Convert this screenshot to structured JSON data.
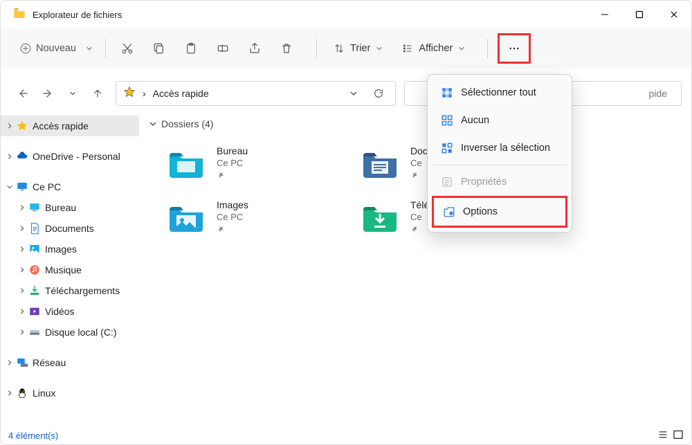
{
  "window": {
    "title": "Explorateur de fichiers"
  },
  "toolbar": {
    "new_label": "Nouveau",
    "sort_label": "Trier",
    "view_label": "Afficher"
  },
  "address": {
    "crumb_separator": "›",
    "crumb": "Accès rapide"
  },
  "search": {
    "placeholder_tail": "pide"
  },
  "sidebar": {
    "items": [
      {
        "label": "Accès rapide",
        "icon": "star",
        "indent": 1,
        "expander": "right",
        "selected": true
      },
      {
        "label": "OneDrive - Personal",
        "icon": "onedrive",
        "indent": 1,
        "expander": "right"
      },
      {
        "label": "Ce PC",
        "icon": "monitor",
        "indent": 1,
        "expander": "down"
      },
      {
        "label": "Bureau",
        "icon": "desktop",
        "indent": 2,
        "expander": "right"
      },
      {
        "label": "Documents",
        "icon": "doc",
        "indent": 2,
        "expander": "right"
      },
      {
        "label": "Images",
        "icon": "images",
        "indent": 2,
        "expander": "right"
      },
      {
        "label": "Musique",
        "icon": "music",
        "indent": 2,
        "expander": "right"
      },
      {
        "label": "Téléchargements",
        "icon": "download",
        "indent": 2,
        "expander": "right"
      },
      {
        "label": "Vidéos",
        "icon": "video",
        "indent": 2,
        "expander": "right"
      },
      {
        "label": "Disque local (C:)",
        "icon": "disk",
        "indent": 2,
        "expander": "right"
      },
      {
        "label": "Réseau",
        "icon": "network",
        "indent": 1,
        "expander": "right"
      },
      {
        "label": "Linux",
        "icon": "linux",
        "indent": 1,
        "expander": "right"
      }
    ]
  },
  "content": {
    "section_label": "Dossiers (4)",
    "folders": [
      {
        "name": "Bureau",
        "loc": "Ce PC",
        "icon": "desktop-folder"
      },
      {
        "name": "Documents",
        "loc": "Ce PC",
        "icon": "doc-folder",
        "truncated": "Doc"
      },
      {
        "name": "Images",
        "loc": "Ce PC",
        "icon": "images-folder"
      },
      {
        "name": "Téléchargements",
        "loc": "Ce PC",
        "icon": "download-folder",
        "truncated": "Télé"
      }
    ]
  },
  "menu": {
    "items": [
      {
        "label": "Sélectionner tout",
        "icon": "select-all"
      },
      {
        "label": "Aucun",
        "icon": "select-none"
      },
      {
        "label": "Inverser la sélection",
        "icon": "select-invert"
      }
    ],
    "properties_label": "Propriétés",
    "options_label": "Options"
  },
  "status": {
    "text": "4 élément(s)"
  }
}
